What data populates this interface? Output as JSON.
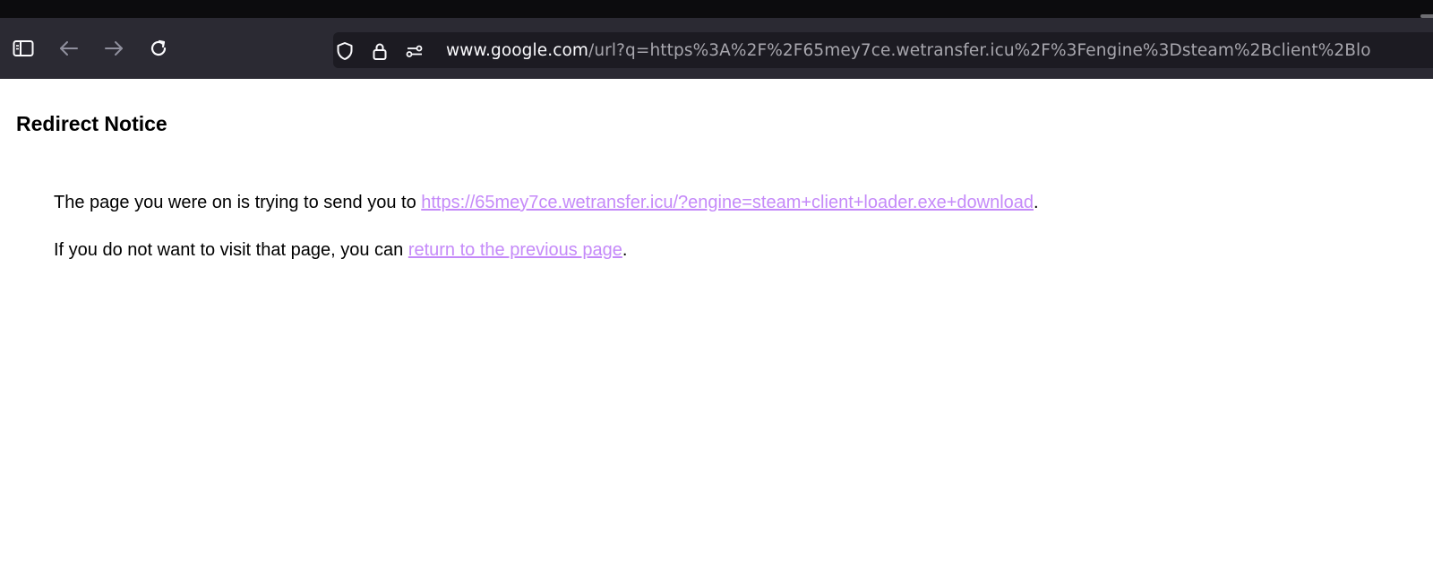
{
  "browser": {
    "url_host": "www.google.com",
    "url_rest": "/url?q=https%3A%2F%2F65mey7ce.wetransfer.icu%2F%3Fengine%3Dsteam%2Bclient%2Blo",
    "icons": {
      "sidebar": "sidebar-icon",
      "back": "back-arrow-icon",
      "forward": "forward-arrow-icon",
      "reload": "reload-icon",
      "shield": "shield-icon",
      "lock": "lock-icon",
      "permissions": "permissions-icon"
    },
    "colors": {
      "toolbar": "#2b2a33",
      "urlbar": "#1c1b22",
      "titlebar": "#0c0c0e"
    }
  },
  "page": {
    "title": "Redirect Notice",
    "line1_prefix": "The page you were on is trying to send you to ",
    "redirect_link": "https://65mey7ce.wetransfer.icu/?engine=steam+client+loader.exe+download",
    "line1_suffix": ".",
    "line2_prefix": "If you do not want to visit that page, you can ",
    "return_link": "return to the previous page",
    "line2_suffix": ".",
    "link_color": "#c58af9"
  }
}
